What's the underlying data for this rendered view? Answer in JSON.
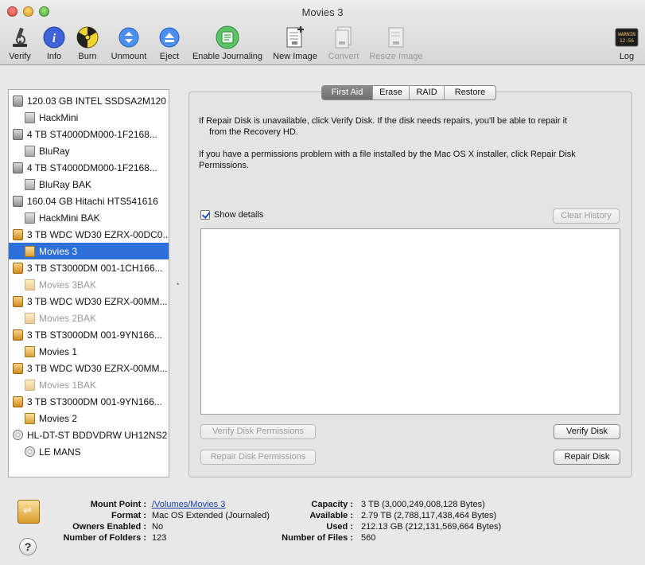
{
  "window": {
    "title": "Movies 3"
  },
  "toolbar": {
    "items": [
      {
        "label": "Verify",
        "icon": "microscope-icon"
      },
      {
        "label": "Info",
        "icon": "info-icon"
      },
      {
        "label": "Burn",
        "icon": "burn-icon"
      },
      {
        "label": "Unmount",
        "icon": "unmount-icon"
      },
      {
        "label": "Eject",
        "icon": "eject-icon"
      },
      {
        "label": "Enable Journaling",
        "icon": "journaling-icon"
      },
      {
        "label": "New Image",
        "icon": "new-image-icon"
      },
      {
        "label": "Convert",
        "icon": "convert-icon"
      },
      {
        "label": "Resize Image",
        "icon": "resize-image-icon"
      },
      {
        "label": "Log",
        "icon": "log-icon"
      }
    ],
    "log_icon_text": "WARNIN 12:56"
  },
  "sidebar": {
    "items": [
      {
        "label": "120.03 GB INTEL SSDSA2M120"
      },
      {
        "label": "HackMini"
      },
      {
        "label": "4 TB ST4000DM000-1F2168..."
      },
      {
        "label": "BluRay"
      },
      {
        "label": "4 TB ST4000DM000-1F2168..."
      },
      {
        "label": "BluRay BAK"
      },
      {
        "label": "160.04 GB Hitachi HTS541616"
      },
      {
        "label": "HackMini BAK"
      },
      {
        "label": "3 TB WDC WD30 EZRX-00DC0..."
      },
      {
        "label": "Movies 3"
      },
      {
        "label": "3 TB ST3000DM 001-1CH166..."
      },
      {
        "label": "Movies 3BAK"
      },
      {
        "label": "3 TB WDC WD30 EZRX-00MM..."
      },
      {
        "label": "Movies 2BAK"
      },
      {
        "label": "3 TB ST3000DM 001-9YN166..."
      },
      {
        "label": "Movies 1"
      },
      {
        "label": "3 TB WDC WD30 EZRX-00MM..."
      },
      {
        "label": "Movies 1BAK"
      },
      {
        "label": "3 TB ST3000DM 001-9YN166..."
      },
      {
        "label": "Movies 2"
      },
      {
        "label": "HL-DT-ST BDDVDRW UH12NS2"
      },
      {
        "label": "LE MANS"
      }
    ],
    "selected": "Movies 3"
  },
  "tabs": [
    {
      "label": "First Aid"
    },
    {
      "label": "Erase"
    },
    {
      "label": "RAID"
    },
    {
      "label": "Restore"
    }
  ],
  "first_aid": {
    "info1": "If Repair Disk is unavailable, click Verify Disk. If the disk needs repairs, you'll be able to repair it",
    "info1b": "from the Recovery HD.",
    "info2": "If you have a permissions problem with a file installed by the Mac OS X installer, click Repair Disk",
    "info2b": "Permissions.",
    "show_details": "Show details",
    "clear_history": "Clear History",
    "verify_permissions": "Verify Disk Permissions",
    "verify_disk": "Verify Disk",
    "repair_permissions": "Repair Disk Permissions",
    "repair_disk": "Repair Disk"
  },
  "details": {
    "mount_point_label": "Mount Point :",
    "mount_point": "/Volumes/Movies 3",
    "format_label": "Format :",
    "format": "Mac OS Extended (Journaled)",
    "owners_label": "Owners Enabled :",
    "owners": "No",
    "folders_label": "Number of Folders :",
    "folders": "123",
    "capacity_label": "Capacity :",
    "capacity": "3 TB (3,000,249,008,128 Bytes)",
    "available_label": "Available :",
    "available": "2.79 TB (2,788,117,438,464 Bytes)",
    "used_label": "Used :",
    "used": "212.13 GB (212,131,569,664 Bytes)",
    "files_label": "Number of Files :",
    "files": "560"
  },
  "help_label": "?"
}
